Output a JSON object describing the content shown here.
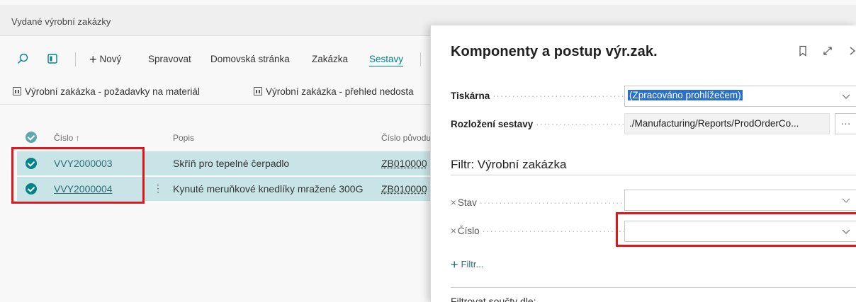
{
  "app": {
    "title": "Vydané výrobní zakázky"
  },
  "actionbar": {
    "new_label": "Nový",
    "manage": "Spravovat",
    "home": "Domovská stránka",
    "order": "Zakázka",
    "reports": "Sestavy"
  },
  "report_links": [
    "Výrobní zakázka - požadavky na materiál",
    "Výrobní zakázka - přehled nedosta"
  ],
  "grid": {
    "col_no": "Číslo ↑",
    "col_desc": "Popis",
    "col_source": "Číslo původu",
    "rows": [
      {
        "no": "VVY2000003",
        "desc": "Skříň pro tepelné čerpadlo",
        "source": "ZB010000"
      },
      {
        "no": "VVY2000004",
        "desc": "Kynuté meruňkové knedlíky mražené 300G",
        "source": "ZB010000"
      }
    ]
  },
  "panel": {
    "title": "Komponenty a postup výr.zak.",
    "printer_label": "Tiskárna",
    "printer_value": "(Zpracováno prohlížečem)",
    "layout_label": "Rozložení sestavy",
    "layout_value": "./Manufacturing/Reports/ProdOrderCo...",
    "ellipsis": "···",
    "filter_title": "Filtr: Výrobní zakázka",
    "filter_status": "Stav",
    "filter_no": "Číslo",
    "add_filter": "Filtr...",
    "totals_title": "Filtrovat součty dle:"
  }
}
